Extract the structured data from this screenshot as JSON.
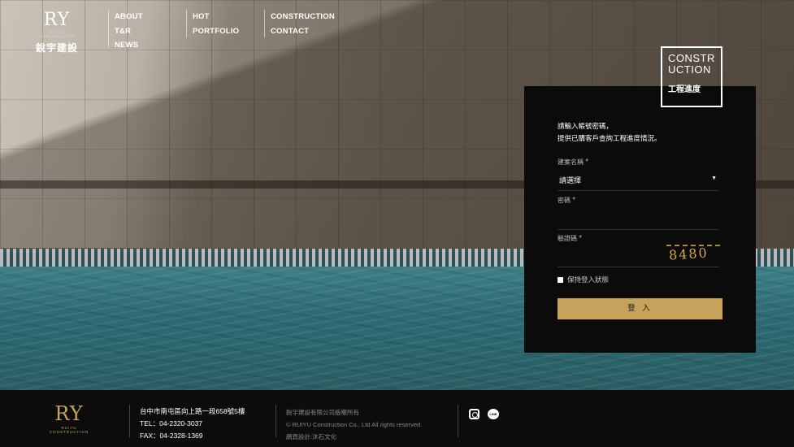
{
  "brand": {
    "logo_mark": "RY",
    "logo_sub": "RUIYU CONSTRUCTION",
    "logo_cn": "銳宇建設"
  },
  "nav": {
    "col1": [
      "ABOUT",
      "T&R",
      "NEWS"
    ],
    "col2": [
      "HOT",
      "PORTFOLIO"
    ],
    "col3": [
      "CONSTRUCTION",
      "CONTACT"
    ]
  },
  "badge": {
    "title_line1": "CONSTR",
    "title_line2": "UCTION",
    "subtitle": "工程進度"
  },
  "login": {
    "intro_line1": "請輸入帳號密碼，",
    "intro_line2": "提供已購客戶查詢工程進度情況。",
    "project_label": "建案名稱",
    "project_value": "請選擇",
    "password_label": "密碼",
    "captcha_label": "驗證碼",
    "required_mark": "*",
    "captcha_text": "8480",
    "remember_label": "保持登入狀態",
    "submit_label": "登 入"
  },
  "footer": {
    "logo_mark": "RY",
    "logo_sub": "RUIYU CONSTRUCTION",
    "address": "台中市南屯區向上路一段658號5樓",
    "tel": "TEL：04-2320-3037",
    "fax": "FAX：04-2328-1369",
    "copyright_cn": "銳宇建設有限公司版權所有",
    "copyright_en": "© RUIYU Construction Co., Ltd All rights reserved.",
    "design_credit": "網頁設計:沐石文化",
    "social": [
      "instagram-icon",
      "line-icon"
    ],
    "line_text": "LINE"
  },
  "colors": {
    "accent_gold": "#c6a25a",
    "panel_bg": "#0b0b0b",
    "footer_bg": "#0c0c0c"
  }
}
